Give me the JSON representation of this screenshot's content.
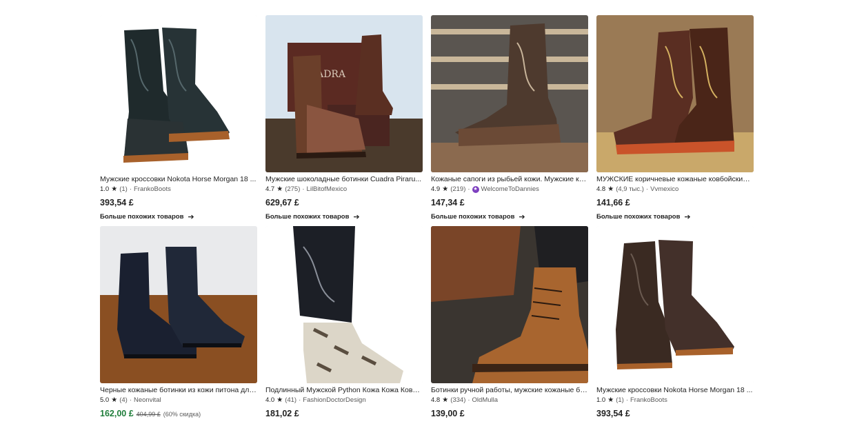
{
  "products": [
    {
      "title": "Мужские кроссовки Nokota Horse Morgan 18 ...",
      "rating": "1.0",
      "reviews": "(1)",
      "shop": "FrankoBoots",
      "star_seller": false,
      "price": "393,54 £",
      "more": "Больше похожих товаров"
    },
    {
      "title": "Мужские шоколадные ботинки Cuadra Piraru...",
      "rating": "4.7",
      "reviews": "(275)",
      "shop": "LilBitofMexico",
      "star_seller": false,
      "price": "629,67 £",
      "more": "Больше похожих товаров",
      "box_text": "CUADRA"
    },
    {
      "title": "Кожаные сапоги из рыбьей кожи. Мужские ко...",
      "rating": "4.9",
      "reviews": "(219)",
      "shop": "WelcomeToDannies",
      "star_seller": true,
      "price": "147,34 £",
      "more": "Больше похожих товаров"
    },
    {
      "title": "МУЖСКИЕ коричневые кожаные ковбойские ...",
      "rating": "4.8",
      "reviews": "(4,9 тыс.)",
      "shop": "Vvmexico",
      "star_seller": false,
      "price": "141,66 £",
      "more": "Больше похожих товаров"
    },
    {
      "title": "Черные кожаные ботинки из кожи питона для...",
      "rating": "5.0",
      "reviews": "(4)",
      "shop": "Neonvital",
      "star_seller": false,
      "price": "162,00 £",
      "old_price": "404,99 £",
      "discount": "(60% скидка)"
    },
    {
      "title": "Подлинный Мужской Python Кожа Кожа Ковб...",
      "rating": "4.0",
      "reviews": "(41)",
      "shop": "FashionDoctorDesign",
      "star_seller": false,
      "price": "181,02 £"
    },
    {
      "title": "Ботинки ручной работы, мужские кожаные бо...",
      "rating": "4.8",
      "reviews": "(334)",
      "shop": "OldMulla",
      "star_seller": false,
      "price": "139,00 £"
    },
    {
      "title": "Мужские кроссовки Nokota Horse Morgan 18 ...",
      "rating": "1.0",
      "reviews": "(1)",
      "shop": "FrankoBoots",
      "star_seller": false,
      "price": "393,54 £"
    }
  ],
  "separator": "·",
  "icons": {
    "star": "star-icon",
    "arrow": "arrow-right-icon",
    "star_seller": "star-seller-badge-icon"
  },
  "colors": {
    "sale_price": "#1e7d3a",
    "star_seller_badge": "#7d3fbf"
  }
}
